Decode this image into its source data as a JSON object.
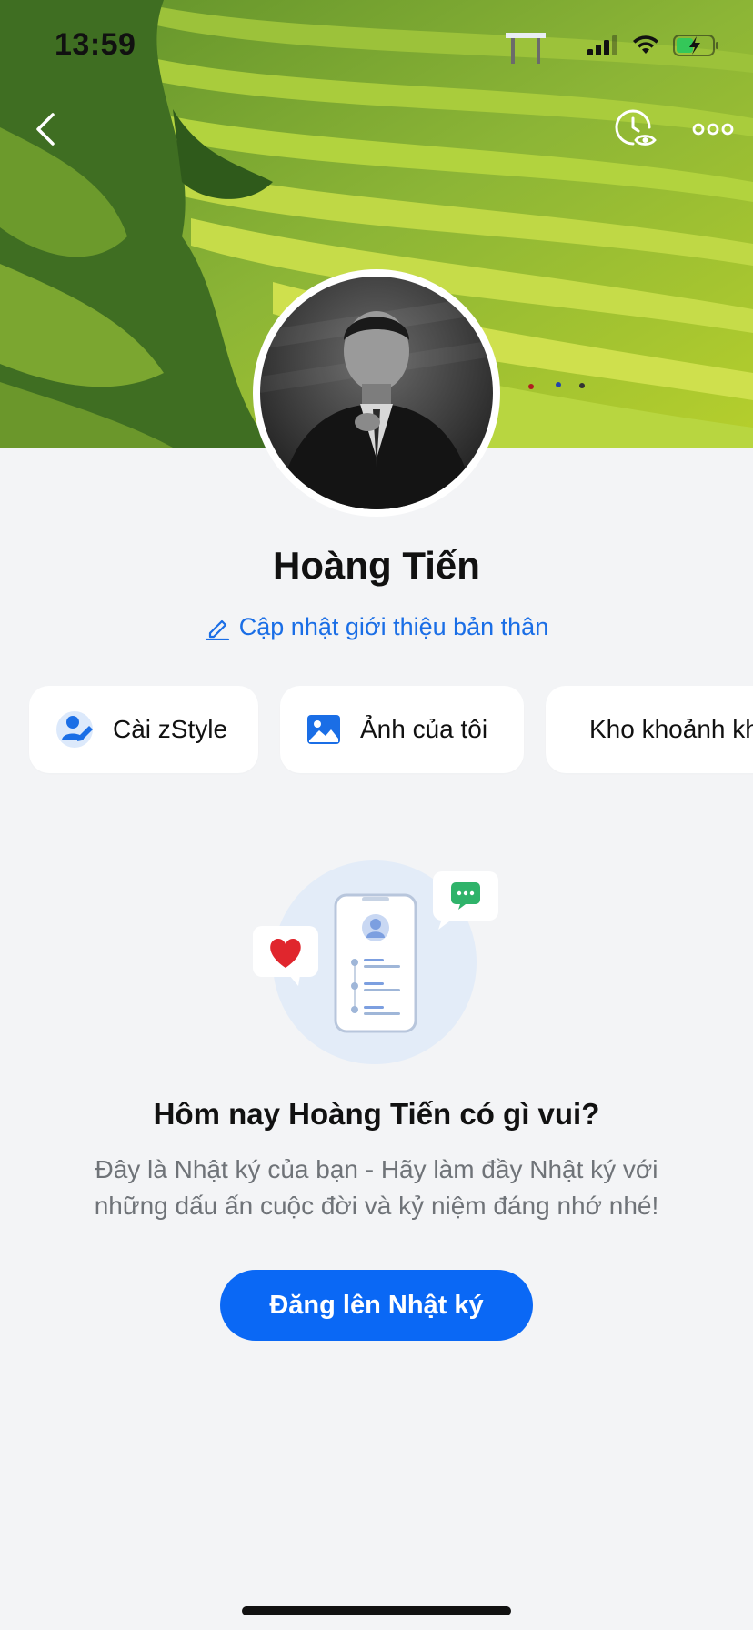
{
  "status_bar": {
    "time": "13:59"
  },
  "icons": {
    "back": "chevron-left-icon",
    "history": "clock-eye-icon",
    "more": "ellipsis-icon",
    "edit": "pencil-icon"
  },
  "profile": {
    "name": "Hoàng Tiến",
    "update_bio_label": "Cập nhật giới thiệu bản thân"
  },
  "quick_actions": [
    {
      "label": "Cài zStyle",
      "icon": "zstyle-icon"
    },
    {
      "label": "Ảnh của tôi",
      "icon": "image-icon"
    },
    {
      "label": "Kho khoảnh khắc",
      "icon": "archive-box-icon"
    }
  ],
  "empty_state": {
    "title": "Hôm nay Hoàng Tiến có gì vui?",
    "description": "Đây là Nhật ký của bạn - Hãy làm đầy Nhật ký với những dấu ấn cuộc đời và kỷ niệm đáng nhớ nhé!",
    "post_button_label": "Đăng lên Nhật ký"
  },
  "colors": {
    "accent": "#0a68f5",
    "link": "#1a6ee6",
    "background": "#f3f4f6"
  }
}
